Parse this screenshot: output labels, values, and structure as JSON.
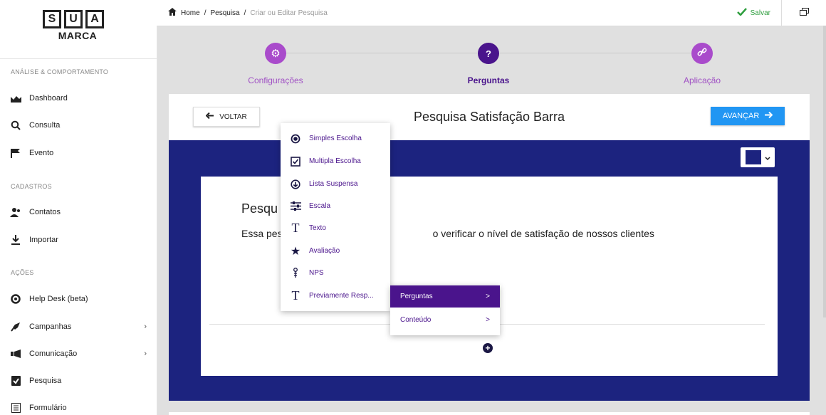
{
  "brand": {
    "letters": [
      "S",
      "U",
      "A"
    ],
    "word": "MARCA"
  },
  "sidebar": {
    "sections": [
      "ANÁLISE & COMPORTAMENTO",
      "CADASTROS",
      "AÇÕES"
    ],
    "items": [
      {
        "label": "Dashboard",
        "icon": "chart-icon"
      },
      {
        "label": "Consulta",
        "icon": "search-icon"
      },
      {
        "label": "Evento",
        "icon": "flag-icon"
      },
      {
        "label": "Contatos",
        "icon": "contacts-icon"
      },
      {
        "label": "Importar",
        "icon": "import-icon"
      },
      {
        "label": "Help Desk (beta)",
        "icon": "lifebuoy-icon"
      },
      {
        "label": "Campanhas",
        "icon": "rocket-icon"
      },
      {
        "label": "Comunicação",
        "icon": "megaphone-icon"
      },
      {
        "label": "Pesquisa",
        "icon": "checklist-icon"
      },
      {
        "label": "Formulário",
        "icon": "form-icon"
      }
    ],
    "chevron": "›"
  },
  "topbar": {
    "breadcrumb": [
      "Home",
      "/",
      "Pesquisa",
      "/",
      "Criar ou Editar Pesquisa"
    ],
    "save_label": "Salvar"
  },
  "steps": [
    {
      "label": "Configurações",
      "glyph": "⚙"
    },
    {
      "label": "Perguntas",
      "glyph": "?"
    },
    {
      "label": "Aplicação",
      "glyph": "🔗"
    }
  ],
  "header": {
    "back_label": "VOLTAR",
    "title": "Pesquisa Satisfação Barra",
    "next_label": "AVANÇAR"
  },
  "form": {
    "title_partial": "Pesqu",
    "desc_left": "Essa pes",
    "desc_right": "o verificar o nível de satisfação de nossos clientes",
    "add_glyph": "+"
  },
  "question_menu": [
    {
      "label": "Simples Escolha",
      "icon": "radio-icon"
    },
    {
      "label": "Multipla Escolha",
      "icon": "checkbox-icon"
    },
    {
      "label": "Lista Suspensa",
      "icon": "dropdown-circle-icon"
    },
    {
      "label": "Escala",
      "icon": "sliders-icon"
    },
    {
      "label": "Texto",
      "icon": "text-icon"
    },
    {
      "label": "Avaliação",
      "icon": "star-icon"
    },
    {
      "label": "NPS",
      "icon": "nps-icon"
    },
    {
      "label": "Previamente Resp...",
      "icon": "text-icon"
    }
  ],
  "submenu": [
    {
      "label": "Perguntas",
      "chev": ">"
    },
    {
      "label": "Conteúdo",
      "chev": ">"
    }
  ],
  "colors": {
    "accent": "#7b2fb0",
    "active_step": "#4a148c",
    "panel": "#1c237f",
    "primary": "#2196f3",
    "save": "#2e9e3e"
  }
}
